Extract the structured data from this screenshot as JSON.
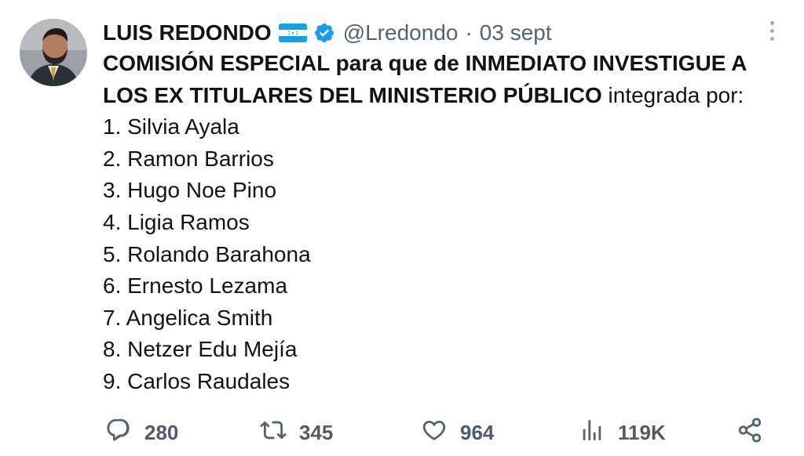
{
  "tweet": {
    "author_name": "LUIS REDONDO",
    "handle": "@Lredondo",
    "separator": "·",
    "date": "03 sept",
    "flag_icon": "honduras-flag-icon",
    "verified_icon": "verified-badge-icon",
    "colors": {
      "verified": "#1d9bf0",
      "flag_blue": "#18a0e0",
      "text": "#0f1419",
      "muted": "#536471"
    },
    "text_bold": "COMISIÓN ESPECIAL para que de INMEDIATO INVESTIGUE A LOS EX TITULARES DEL MINISTERIO PÚBLICO",
    "text_normal": " integrada por:",
    "members": [
      "1. Silvia Ayala",
      "2. Ramon Barrios",
      "3. Hugo Noe Pino",
      "4. Ligia Ramos",
      "5. Rolando Barahona",
      "6. Ernesto Lezama",
      "7. Angelica Smith",
      "8. Netzer Edu Mejía",
      "9. Carlos Raudales"
    ]
  },
  "actions": {
    "replies": {
      "icon": "reply-icon",
      "count": "280"
    },
    "retweets": {
      "icon": "retweet-icon",
      "count": "345"
    },
    "likes": {
      "icon": "heart-icon",
      "count": "964"
    },
    "views": {
      "icon": "views-icon",
      "count": "119K"
    },
    "share": {
      "icon": "share-icon"
    }
  }
}
